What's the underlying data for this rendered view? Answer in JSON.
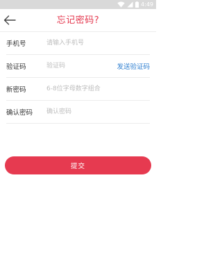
{
  "status_bar": {
    "time": "4:49",
    "icons": [
      "wifi-icon",
      "cellular-signal-icon",
      "battery-icon"
    ]
  },
  "header": {
    "title": "忘记密码?",
    "back_icon": "arrow-left-icon"
  },
  "form": {
    "phone": {
      "label": "手机号",
      "placeholder": "请输入手机号",
      "value": ""
    },
    "verify_code": {
      "label": "验证码",
      "placeholder": "验证码",
      "value": "",
      "send_label": "发送验证码"
    },
    "new_password": {
      "label": "新密码",
      "placeholder": "6-8位字母数字组合",
      "value": ""
    },
    "confirm_password": {
      "label": "确认密码",
      "placeholder": "确认密码",
      "value": ""
    },
    "submit_label": "提交"
  },
  "colors": {
    "accent": "#e4394f",
    "button": "#e63a50",
    "link": "#2f7fd0",
    "status_bar": "#d9d9d9",
    "divider": "#ececec",
    "placeholder": "#bdbdbd"
  }
}
